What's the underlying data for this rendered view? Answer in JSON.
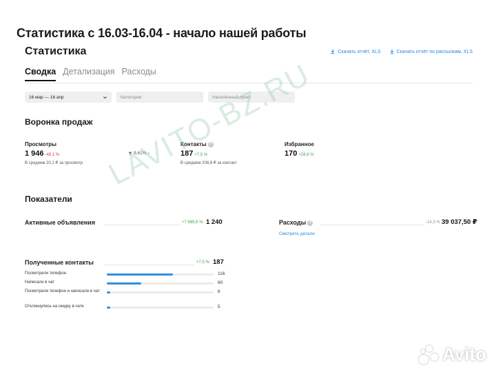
{
  "headline": "Статистика с 16.03-16.04 - начало нашей работы",
  "page_title": "Статистика",
  "downloads": {
    "report_xls": "Скачать отчёт, XLS",
    "mailing_report_xls": "Скачать отчёт по рассылкам, XLS"
  },
  "tabs": [
    {
      "label": "Сводка",
      "active": true
    },
    {
      "label": "Детализация",
      "active": false
    },
    {
      "label": "Расходы",
      "active": false
    }
  ],
  "filters": {
    "date_range": "16 мар — 16 апр",
    "category_placeholder": "Категория",
    "location_placeholder": "Населённый пункт"
  },
  "funnel": {
    "title": "Воронка продаж",
    "views": {
      "label": "Просмотры",
      "value": "1 946",
      "delta": "-48.1 %",
      "sub": "В среднем 20,1 ₽ за просмотр"
    },
    "conversion": "9,61%",
    "contacts": {
      "label": "Контакты",
      "value": "187",
      "delta": "+7,5 %",
      "sub": "В среднем 208,8 ₽ за контакт"
    },
    "favorites": {
      "label": "Избранное",
      "value": "170",
      "delta": "+28,6 %"
    }
  },
  "indicators": {
    "title": "Показатели",
    "active_ads": {
      "label": "Активные объявления",
      "delta": "+7 685,6 %",
      "value": "1 240"
    },
    "expenses": {
      "label": "Расходы",
      "delta": "-14,3 %",
      "value": "39 037,50 ₽",
      "details_link": "Смотреть детали"
    },
    "contacts_received": {
      "label": "Полученные контакты",
      "delta": "+7,5 %",
      "value": "187"
    },
    "breakdown": [
      {
        "label": "Посмотрели телефон",
        "value": "116",
        "share": 0.62
      },
      {
        "label": "Написали в чат",
        "value": "60",
        "share": 0.32
      },
      {
        "label": "Посмотрели телефон и написали в чат",
        "value": "6",
        "share": 0.03
      },
      {
        "label": "Откликнулись на скидку в чате",
        "value": "5",
        "share": 0.03
      }
    ]
  },
  "watermark": "LAVITO-BZ.RU",
  "logo": "Avito",
  "colors": {
    "accent": "#1e88e5",
    "positive": "#43a047",
    "negative": "#e53935",
    "bar": "#2f8fe0"
  }
}
